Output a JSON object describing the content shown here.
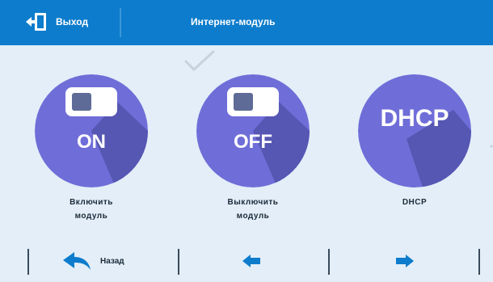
{
  "header": {
    "exit_label": "Выход",
    "title": "Интернет-модуль",
    "exit_icon": "exit-door-icon",
    "accent_color": "#0d7ccc"
  },
  "tiles": [
    {
      "caption": "ON",
      "label_line1": "Включить",
      "label_line2": "модуль",
      "icon": "toggle-on-icon"
    },
    {
      "caption": "OFF",
      "label_line1": "Выключить",
      "label_line2": "модуль",
      "icon": "toggle-off-icon"
    },
    {
      "caption": "DHCP",
      "label_line1": "DHCP",
      "label_line2": "",
      "icon": "dhcp-icon"
    }
  ],
  "selected_tile": "OFF",
  "footer": {
    "back_label": "Назад",
    "back_icon": "back-arrow-icon",
    "prev_icon": "arrow-left-icon",
    "next_icon": "arrow-right-icon"
  },
  "colors": {
    "circle": "#6f6ed8",
    "circle_shadow": "#5656b3",
    "background": "#e3eef8",
    "icon_blue": "#0d7ccc"
  }
}
